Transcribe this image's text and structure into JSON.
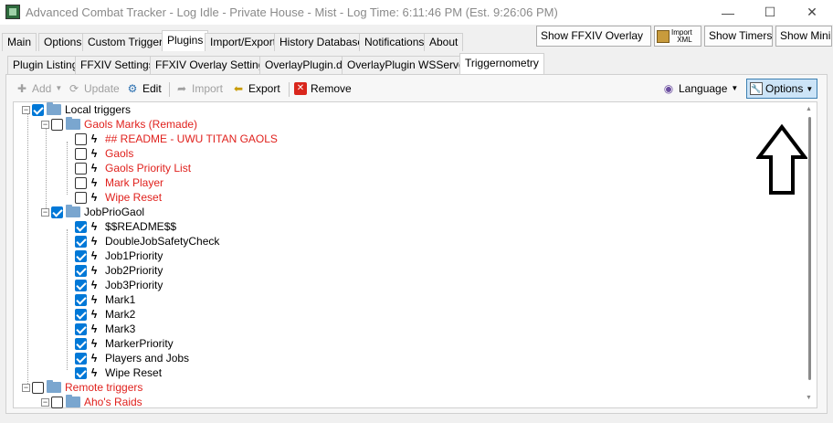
{
  "window": {
    "title": "Advanced Combat Tracker - Log Idle - Private House - Mist - Log Time: 6:11:46 PM (Est. 9:26:06 PM)",
    "minimize": "—",
    "maximize": "☐",
    "close": "✕"
  },
  "main_tabs": [
    "Main",
    "Options",
    "Custom Triggers",
    "Plugins",
    "Import/Export",
    "History Database",
    "Notifications",
    "About"
  ],
  "top_buttons": {
    "show_overlay": "Show FFXIV Overlay",
    "import_xml_line1": "Import",
    "import_xml_line2": "XML",
    "show_timers": "Show Timers",
    "show_mini": "Show Mini"
  },
  "plugin_tabs": [
    "Plugin Listing",
    "FFXIV Settings",
    "FFXIV Overlay Settings",
    "OverlayPlugin.dll",
    "OverlayPlugin WSServer",
    "Triggernometry"
  ],
  "toolbar": {
    "add": "Add",
    "update": "Update",
    "edit": "Edit",
    "import": "Import",
    "export": "Export",
    "remove": "Remove",
    "language": "Language",
    "options": "Options"
  },
  "tree": {
    "local_triggers": "Local triggers",
    "gaols_folder": "Gaols Marks (Remade)",
    "gaols_items": [
      "## README - UWU TITAN GAOLS",
      "Gaols",
      "Gaols Priority List",
      "Mark Player",
      "Wipe Reset"
    ],
    "jobprio_folder": "JobPrioGaol",
    "jobprio_items": [
      "$$README$$",
      "DoubleJobSafetyCheck",
      "Job1Priority",
      "Job2Priority",
      "Job3Priority",
      "Mark1",
      "Mark2",
      "Mark3",
      "MarkerPriority",
      "Players and Jobs",
      "Wipe Reset"
    ],
    "remote_triggers": "Remote triggers",
    "remote_item": "Aho's Raids"
  },
  "colors": {
    "accent": "#0078d7",
    "red_text": "#e0211d"
  }
}
